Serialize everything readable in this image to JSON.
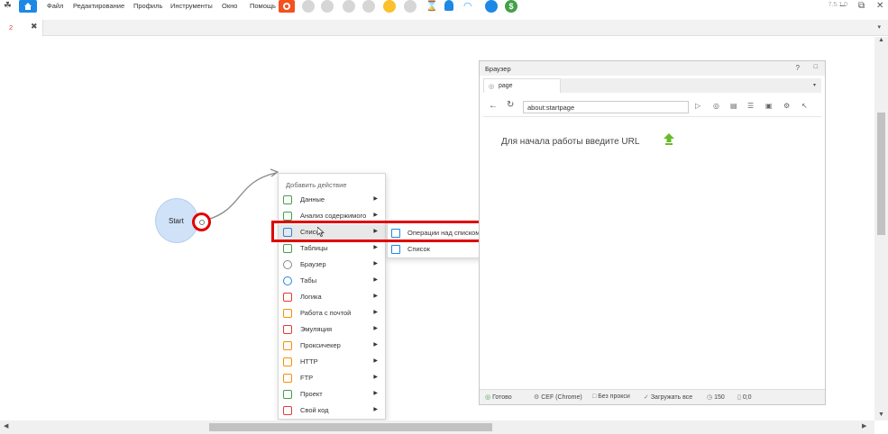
{
  "window": {
    "version": "7.5.1.0"
  },
  "menu": {
    "items": [
      "Файл",
      "Редактирование",
      "Профиль",
      "Инструменты",
      "Окно",
      "Помощь"
    ]
  },
  "toolbar_icons": [
    {
      "name": "record-icon",
      "color": "#f4511e"
    },
    {
      "name": "stop-icon",
      "color": "#cfcfcf"
    },
    {
      "name": "pause-icon",
      "color": "#cfcfcf"
    },
    {
      "name": "step-icon",
      "color": "#cfcfcf"
    },
    {
      "name": "skip-icon",
      "color": "#cfcfcf"
    },
    {
      "name": "bulb-icon",
      "color": "#fbc02d"
    },
    {
      "name": "clear-icon",
      "color": "#cfcfcf"
    },
    {
      "name": "hourglass-icon",
      "color": "#8d6e63"
    },
    {
      "name": "user-icon",
      "color": "#1e88e5"
    },
    {
      "name": "eye-icon",
      "color": "#42a5f5"
    },
    {
      "name": "users-icon",
      "color": "#1e88e5"
    },
    {
      "name": "dollar-icon",
      "color": "#43a047"
    }
  ],
  "tabs": [
    {
      "number": "2"
    }
  ],
  "canvas": {
    "start_label": "Start"
  },
  "context_menu": {
    "header": "Добавить действие",
    "items": [
      {
        "label": "Данные",
        "icon": "user-icon",
        "color": "#43a047"
      },
      {
        "label": "Анализ содержимого",
        "icon": "analysis-icon",
        "color": "#43a047"
      },
      {
        "label": "Списки",
        "icon": "list-icon",
        "color": "#1e88e5"
      },
      {
        "label": "Таблицы",
        "icon": "table-icon",
        "color": "#43a047"
      },
      {
        "label": "Браузер",
        "icon": "gear-icon",
        "color": "#888888"
      },
      {
        "label": "Табы",
        "icon": "globe-icon",
        "color": "#1e88e5"
      },
      {
        "label": "Логика",
        "icon": "logic-icon",
        "color": "#e53935"
      },
      {
        "label": "Работа с почтой",
        "icon": "mail-icon",
        "color": "#fb8c00"
      },
      {
        "label": "Эмуляция",
        "icon": "emulation-icon",
        "color": "#e53935"
      },
      {
        "label": "Проксичекер",
        "icon": "proxy-icon",
        "color": "#fb8c00"
      },
      {
        "label": "HTTP",
        "icon": "http-icon",
        "color": "#fb8c00"
      },
      {
        "label": "FTP",
        "icon": "ftp-icon",
        "color": "#fb8c00"
      },
      {
        "label": "Проект",
        "icon": "project-icon",
        "color": "#43a047"
      },
      {
        "label": "Свой код",
        "icon": "csharp-icon",
        "color": "#e53935"
      }
    ]
  },
  "submenu": {
    "items": [
      "Операции над списком",
      "Список"
    ]
  },
  "browser": {
    "title": "Браузер",
    "help": "?",
    "tab_label": "page",
    "url": "about:startpage",
    "start_text": "Для начала работы введите URL",
    "status": {
      "ready": "Готово",
      "engine": "CEF (Chrome)",
      "proxy": "Без прокси",
      "load": "Загружать все",
      "count": "150",
      "coords": "0;0"
    }
  }
}
